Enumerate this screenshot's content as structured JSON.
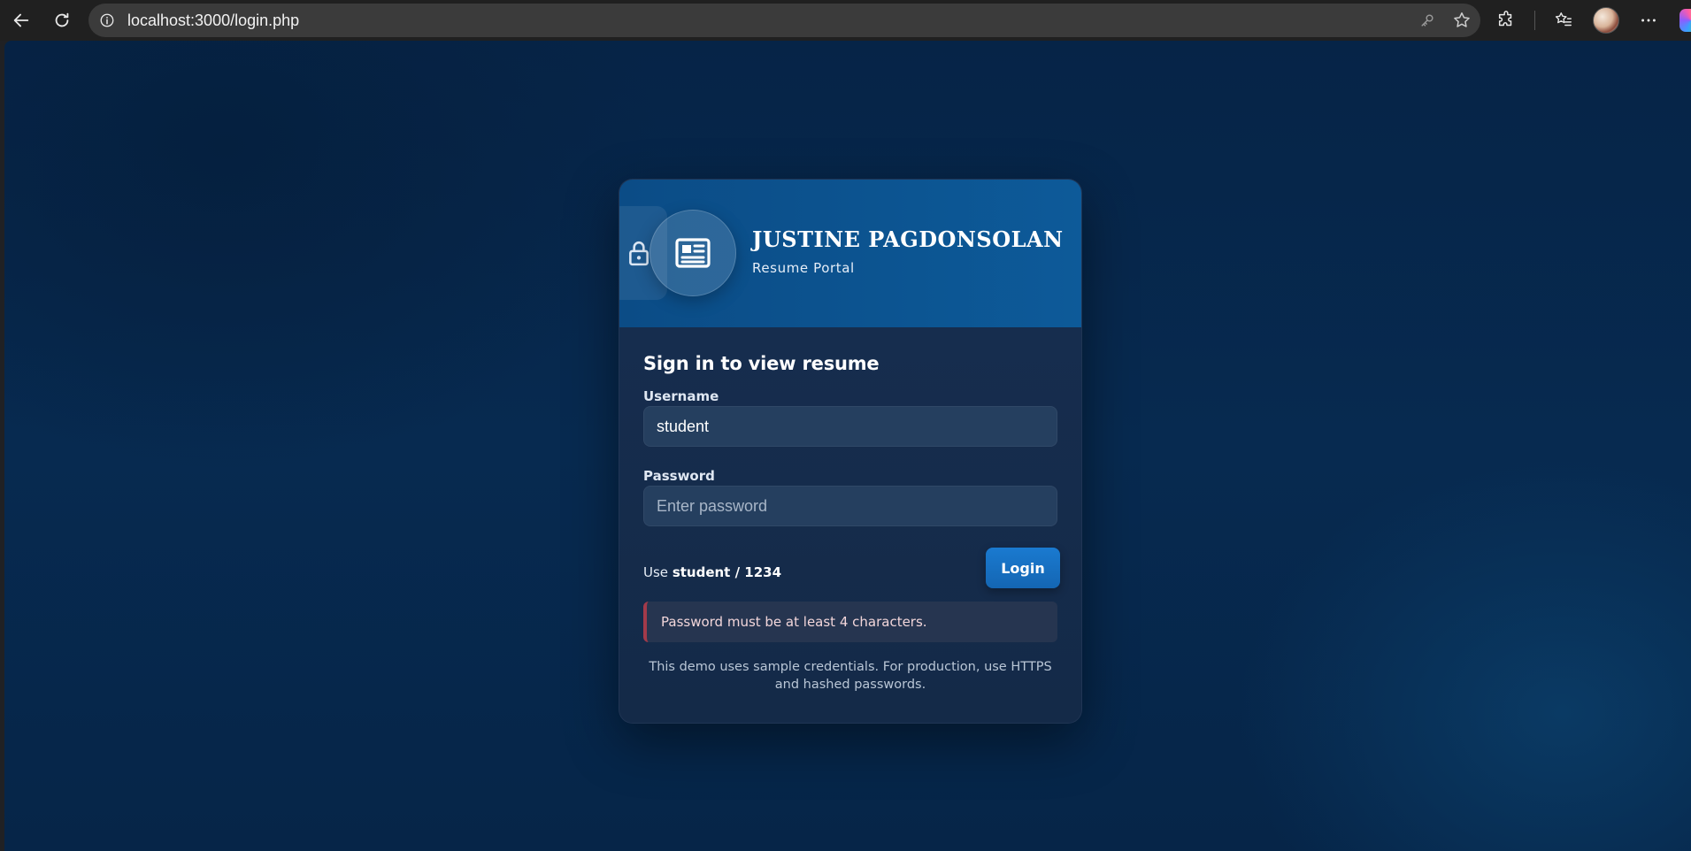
{
  "browser": {
    "url": "localhost:3000/login.php",
    "icons": {
      "back": "back-arrow-icon",
      "reload": "reload-icon",
      "site_info": "info-icon",
      "password": "key-icon",
      "favorite": "star-icon",
      "extensions": "puzzle-icon",
      "favorites": "favorites-list-icon",
      "profile": "avatar",
      "more": "more-dots-icon",
      "copilot": "copilot-icon"
    }
  },
  "header": {
    "name": "JUSTINE PAGDONSOLAN",
    "subtitle": "Resume Portal",
    "logo_icon": "newspaper-icon",
    "side_icon": "lock-icon"
  },
  "form": {
    "title": "Sign in to view resume",
    "username_label": "Username",
    "username_value": "student",
    "password_label": "Password",
    "password_placeholder": "Enter password",
    "hint_prefix": "Use",
    "hint_credentials": "student / 1234",
    "login_label": "Login",
    "error_message": "Password must be at least 4 characters.",
    "footnote": "This demo uses sample credentials. For production, use HTTPS and hashed passwords."
  },
  "colors": {
    "page_bg": "#062447",
    "header_bg": "#0d5a99",
    "card_body": "#142a48",
    "button": "#1a7ad0",
    "error_accent": "#a23a4a"
  }
}
